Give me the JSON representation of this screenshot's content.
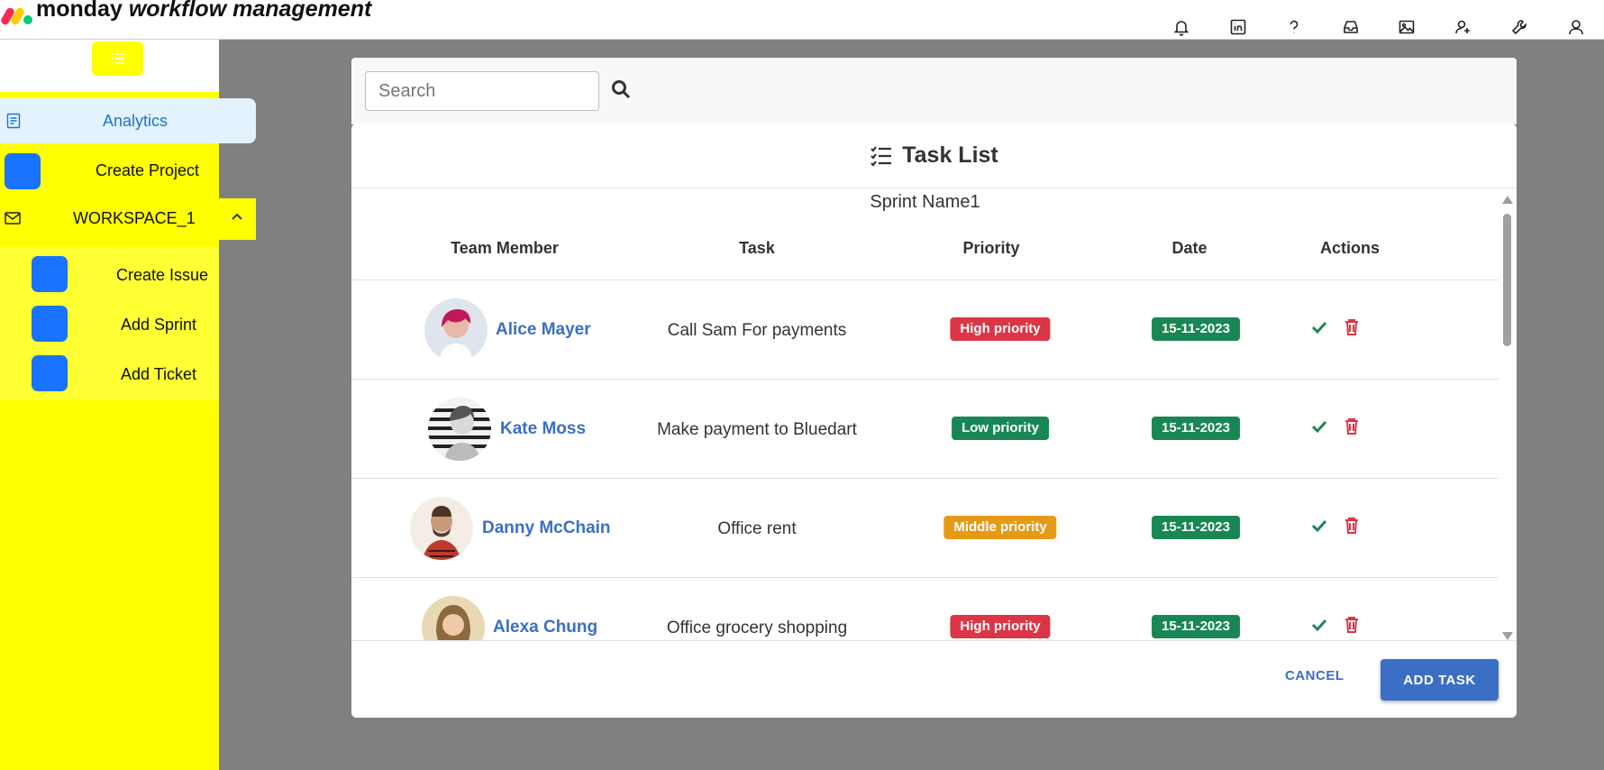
{
  "app": {
    "logo_word": "monday",
    "logo_tagline": "workflow management"
  },
  "topbar": {
    "icons": [
      "bell-icon",
      "linkedin-icon",
      "help-icon",
      "inbox-icon",
      "image-icon",
      "user-add-icon",
      "wrench-icon",
      "user-icon"
    ]
  },
  "sidebar": {
    "analytics_label": "Analytics",
    "create_project_label": "Create Project",
    "workspace_label": "WORKSPACE_1",
    "sub_items": [
      {
        "label": "Create Issue"
      },
      {
        "label": "Add Sprint"
      },
      {
        "label": "Add Ticket"
      }
    ]
  },
  "search": {
    "placeholder": "Search"
  },
  "task_list": {
    "title": "Task List",
    "sprint_name": "Sprint Name1",
    "columns": {
      "member": "Team Member",
      "task": "Task",
      "priority": "Priority",
      "date": "Date",
      "actions": "Actions"
    },
    "rows": [
      {
        "member": "Alice Mayer",
        "task": "Call Sam For payments",
        "priority": "High priority",
        "date": "15-11-2023"
      },
      {
        "member": "Kate Moss",
        "task": "Make payment to Bluedart",
        "priority": "Low priority",
        "date": "15-11-2023"
      },
      {
        "member": "Danny McChain",
        "task": "Office rent",
        "priority": "Middle priority",
        "date": "15-11-2023"
      },
      {
        "member": "Alexa Chung",
        "task": "Office grocery shopping",
        "priority": "High priority",
        "date": "15-11-2023"
      }
    ]
  },
  "footer": {
    "cancel_label": "CANCEL",
    "add_label": "ADD TASK"
  },
  "colors": {
    "sidebar_bg": "#ffff00",
    "accent": "#3b6fc6",
    "high": "#dc3545",
    "low": "#198754",
    "middle": "#e69b16",
    "date": "#198754",
    "overlay": "#808080"
  }
}
